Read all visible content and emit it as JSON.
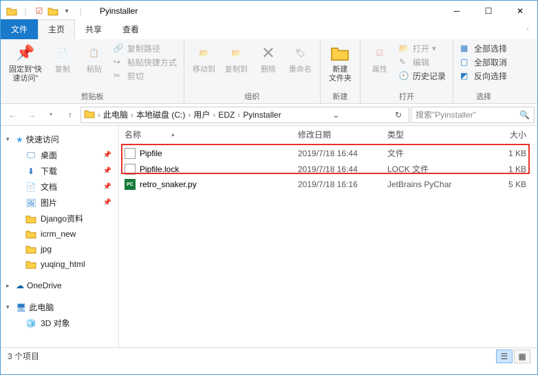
{
  "window": {
    "title": "Pyinstaller"
  },
  "tabs": {
    "file": "文件",
    "home": "主页",
    "share": "共享",
    "view": "查看"
  },
  "ribbon": {
    "pin": {
      "label": "固定到\"快\n速访问\""
    },
    "copy": {
      "label": "复制"
    },
    "paste": {
      "label": "粘贴"
    },
    "copypath": "复制路径",
    "pasteshortcut": "粘贴快捷方式",
    "cut": "剪切",
    "clipboard_group": "剪贴板",
    "moveto": {
      "label": "移动到"
    },
    "copyto": {
      "label": "复制到"
    },
    "delete": {
      "label": "删除"
    },
    "rename": {
      "label": "重命名"
    },
    "organize_group": "组织",
    "newfolder": {
      "label": "新建\n文件夹"
    },
    "new_group": "新建",
    "properties": {
      "label": "属性"
    },
    "open": "打开",
    "edit": "编辑",
    "history": "历史记录",
    "open_group": "打开",
    "selectall": "全部选择",
    "selectnone": "全部取消",
    "invertselect": "反向选择",
    "select_group": "选择"
  },
  "breadcrumb": {
    "p0": "此电脑",
    "p1": "本地磁盘 (C:)",
    "p2": "用户",
    "p3": "EDZ",
    "p4": "Pyinstaller"
  },
  "search": {
    "placeholder": "搜索\"Pyinstaller\""
  },
  "sidebar": {
    "quick": "快速访问",
    "items": [
      "桌面",
      "下载",
      "文档",
      "图片",
      "Django资料",
      "icrm_new",
      "jpg",
      "yuqing_html"
    ],
    "onedrive": "OneDrive",
    "thispc": "此电脑",
    "obj3d": "3D 对象"
  },
  "columns": {
    "name": "名称",
    "modified": "修改日期",
    "type": "类型",
    "size": "大小"
  },
  "files": [
    {
      "name": "Pipfile",
      "modified": "2019/7/18 16:44",
      "type": "文件",
      "size": "1 KB",
      "icon": "file"
    },
    {
      "name": "Pipfile.lock",
      "modified": "2019/7/18 16:44",
      "type": "LOCK 文件",
      "size": "1 KB",
      "icon": "file"
    },
    {
      "name": "retro_snaker.py",
      "modified": "2019/7/18 16:16",
      "type": "JetBrains PyChar",
      "size": "5 KB",
      "icon": "pc"
    }
  ],
  "status": {
    "count": "3 个项目"
  }
}
